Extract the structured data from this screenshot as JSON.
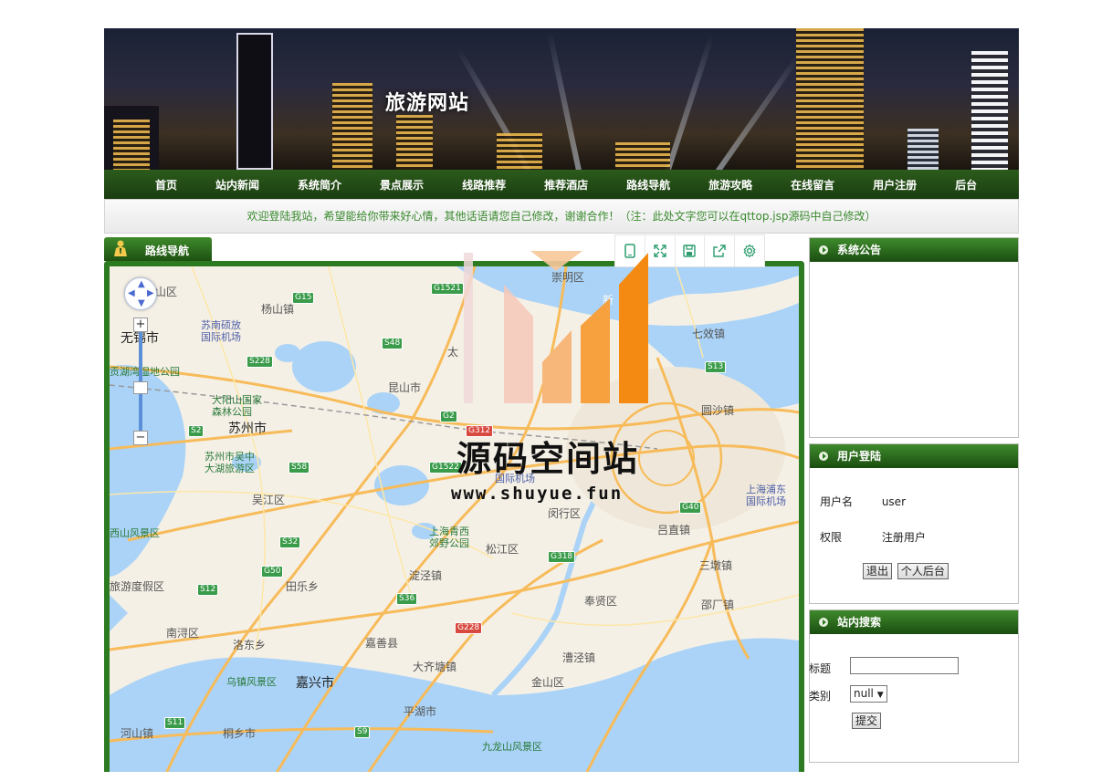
{
  "site": {
    "title": "旅游网站"
  },
  "nav": {
    "items": [
      "首页",
      "站内新闻",
      "系统简介",
      "景点展示",
      "线路推荐",
      "推荐酒店",
      "路线导航",
      "旅游攻略",
      "在线留言",
      "用户注册",
      "后台"
    ]
  },
  "welcome": {
    "text": "欢迎登陆我站，希望能给你带来好心情，其他话语请您自己修改，谢谢合作！（注：此处文字您可以在qttop.jsp源码中自己修改）"
  },
  "route_panel": {
    "tab_label": "路线导航"
  },
  "map": {
    "labels": {
      "wuxi": "无锡市",
      "yangshan": "杨山镇",
      "suzhou": "苏州市",
      "kunshan": "昆山市",
      "taicang": "太",
      "wujiang": "吴江区",
      "songjiang": "松江区",
      "jiashan": "嘉善县",
      "jiaxing": "嘉兴市",
      "jinshan": "金山区",
      "fengxian": "奉贤区",
      "minhang": "闵行区",
      "chongming": "崇明区",
      "tongzhou": "三墩镇",
      "qianhuang": "七效镇",
      "yuansha": "圆沙镇",
      "luodian": "吕直镇",
      "nanxun": "南浔区",
      "luoxiang": "洛东乡",
      "tianlexiang": "田乐乡",
      "dianshan": "淀泾镇",
      "dazhou": "大齐塘镇",
      "pinghu": "平湖市",
      "caojing": "漕泾镇",
      "tongxiang": "桐乡市",
      "heshan": "河山镇",
      "fenghe": "邵厂镇",
      "jiaojiang": "新",
      "wuxi_airport": "苏南硕放\n国际机场",
      "pudong_airport": "上海浦东\n国际机场",
      "hongqiao_airport": "国际机场",
      "lake_park": "贡湖湾湿地公园",
      "dayang_park": "大阳山国家\n森林公园",
      "wuzhong_park": "苏州市吴中\n大湖旅游区",
      "qingxi_park": "上海青西\n郊野公园",
      "xishan": "西山风景区",
      "wuzhen": "乌镇风景区",
      "jiulongshan": "九龙山风景区",
      "dujia": "旅游度假区",
      "huishan": "山区"
    },
    "toolbar_icons": [
      "phone-icon",
      "fullscreen-icon",
      "save-icon",
      "share-icon",
      "settings-icon"
    ],
    "pan_icon": "pan-arrows-icon",
    "zoom_in": "+",
    "zoom_out": "−",
    "roads": [
      "G15",
      "G1521",
      "S48",
      "G2",
      "S228",
      "G312",
      "S58",
      "G1522",
      "S32",
      "G318",
      "G50",
      "S12",
      "S36",
      "G228",
      "G40",
      "S13",
      "S11",
      "S9",
      "S2"
    ]
  },
  "watermark": {
    "title": "源码空间站",
    "url": "www.shuyue.fun"
  },
  "notice_panel": {
    "title": "系统公告"
  },
  "login_panel": {
    "title": "用户登陆",
    "username_label": "用户名",
    "username_value": "user",
    "role_label": "权限",
    "role_value": "注册用户",
    "logout_button": "退出",
    "dashboard_button": "个人后台"
  },
  "search_panel": {
    "title": "站内搜索",
    "title_label": "标题",
    "title_value": "",
    "category_label": "类别",
    "category_value": "null",
    "submit_button": "提交"
  },
  "colors": {
    "nav_green": "#1a3d10",
    "accent_green": "#2d7b21",
    "welcome_text": "#3a8a2e",
    "water": "#aad3f7"
  }
}
